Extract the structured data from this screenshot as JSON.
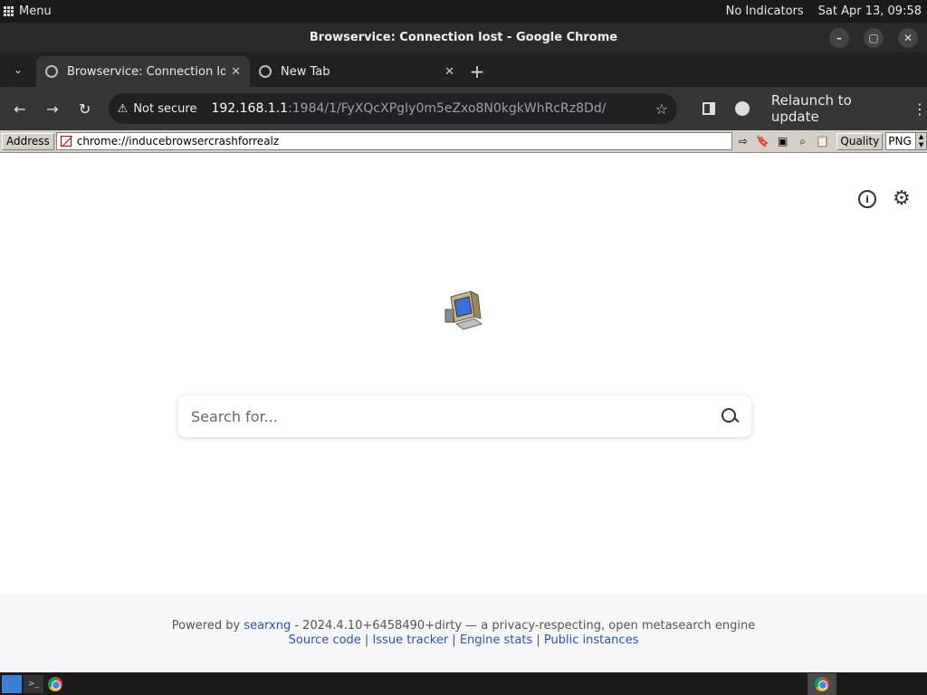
{
  "system_bar": {
    "menu_label": "Menu",
    "indicators": "No Indicators",
    "clock": "Sat Apr 13, 09:58"
  },
  "window": {
    "title": "Browservice: Connection lost - Google Chrome",
    "minimize": "–",
    "maximize": "▢",
    "close": "✕"
  },
  "tabs": [
    {
      "label": "Browservice: Connection lost",
      "close": "✕"
    },
    {
      "label": "New Tab",
      "close": "✕"
    }
  ],
  "tab_strip": {
    "menu_glyph": "⌄",
    "new_tab_glyph": "+"
  },
  "toolbar": {
    "back": "←",
    "forward": "→",
    "reload": "↻",
    "security_warning_glyph": "⚠",
    "security_label": "Not secure",
    "url_host": "192.168.1.1",
    "url_path": ":1984/1/FyXQcXPgIy0m5eZxo8N0kgkWhRcRz8Dd/",
    "bookmark_glyph": "☆",
    "relaunch_label": "Relaunch to update",
    "menu_glyph": "⋮"
  },
  "browservice_bar": {
    "address_label": "Address",
    "address_value": "chrome://inducebrowsercrashforrealz",
    "go_glyph": "⇨",
    "bookmark_glyph": "🔖",
    "find_glyph": "⌕",
    "clipboard_glyph": "📋",
    "image_glyph": "▣",
    "quality_label": "Quality",
    "quality_value": "PNG"
  },
  "page": {
    "info_glyph": "i",
    "settings_glyph": "⚙",
    "search_placeholder": "Search for...",
    "footer": {
      "powered_by": "Powered by",
      "engine_link": "searxng",
      "version_text": " - 2024.4.10+6458490+dirty — a privacy-respecting, open metasearch engine",
      "links": [
        "Source code",
        "Issue tracker",
        "Engine stats",
        "Public instances"
      ],
      "separator": " | "
    }
  }
}
